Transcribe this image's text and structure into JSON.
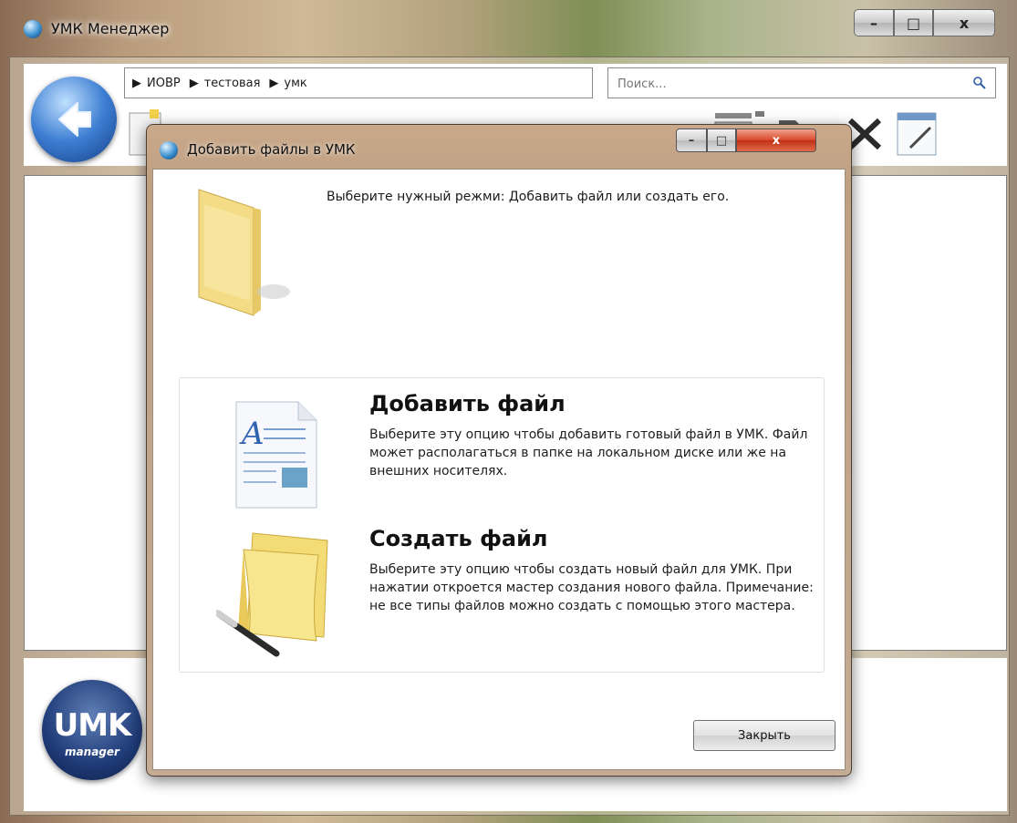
{
  "window": {
    "title": "УМК Менеджер",
    "minimize": "–",
    "maximize": "□",
    "close": "x"
  },
  "breadcrumb": [
    {
      "label": "ИОВР"
    },
    {
      "label": "тестовая"
    },
    {
      "label": "умк"
    }
  ],
  "search": {
    "placeholder": "Поиск...",
    "icon": "search-icon"
  },
  "toolbar": {
    "icons": [
      "new-document-icon",
      "hardware-icon",
      "open-folder-icon",
      "delete-icon",
      "edit-icon"
    ]
  },
  "logo": {
    "big": "UMK",
    "small": "manager"
  },
  "dialog": {
    "title": "Добавить файлы в УМК",
    "minimize": "–",
    "maximize": "□",
    "close": "x",
    "intro": "Выберите нужный режми: Добавить файл или создать его.",
    "options": [
      {
        "title": "Добавить файл",
        "description": "Выберите эту опцию чтобы добавить готовый файл в УМК. Файл может располагаться в папке на локальном диске или же на внешних носителях."
      },
      {
        "title": "Создать файл",
        "description": "Выберите эту опцию чтобы создать новый файл для УМК. При нажатии откроется мастер создания нового файла. Примечание: не все типы файлов можно создать с помощью этого мастера."
      }
    ],
    "close_button": "Закрыть"
  },
  "colors": {
    "accent_blue": "#3d7ed2",
    "dialog_frame": "#c4ab93",
    "close_red": "#d9472a"
  }
}
